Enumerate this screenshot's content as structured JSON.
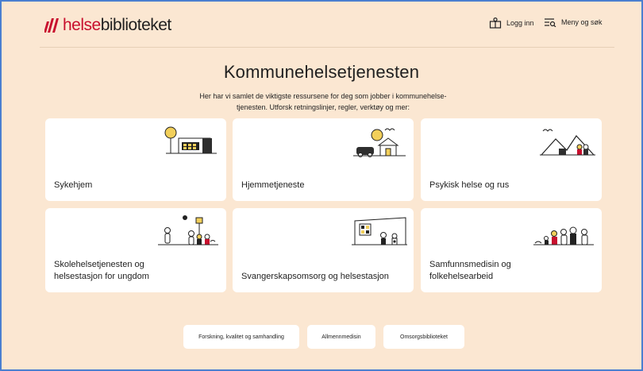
{
  "header": {
    "logo_part1": "helse",
    "logo_part2": "biblioteket",
    "login_label": "Logg inn",
    "menu_label": "Meny og søk"
  },
  "main": {
    "title": "Kommunehelsetjenesten",
    "intro_line1": "Her har vi samlet de viktigste ressursene for deg som jobber i kommunehelse-",
    "intro_line2": "tjenesten. Utforsk retningslinjer, regler, verktøy og mer:"
  },
  "cards": [
    {
      "label": "Sykehjem"
    },
    {
      "label": "Hjemmetjeneste"
    },
    {
      "label": "Psykisk helse og rus"
    },
    {
      "label_line1": "Skolehelsetjenesten og",
      "label_line2": "helsestasjon for ungdom"
    },
    {
      "label": "Svangerskapsomsorg og helsestasjon"
    },
    {
      "label_line1": "Samfunnsmedisin og",
      "label_line2": "folkehelsearbeid"
    }
  ],
  "links": [
    "Forskning, kvalitet og samhandling",
    "Allmennmedisin",
    "Omsorgsbiblioteket"
  ],
  "colors": {
    "brand_red": "#c8102e",
    "background": "#fbe7d2",
    "frame": "#4a7fd0",
    "illustration_yellow": "#f2cf5a"
  }
}
